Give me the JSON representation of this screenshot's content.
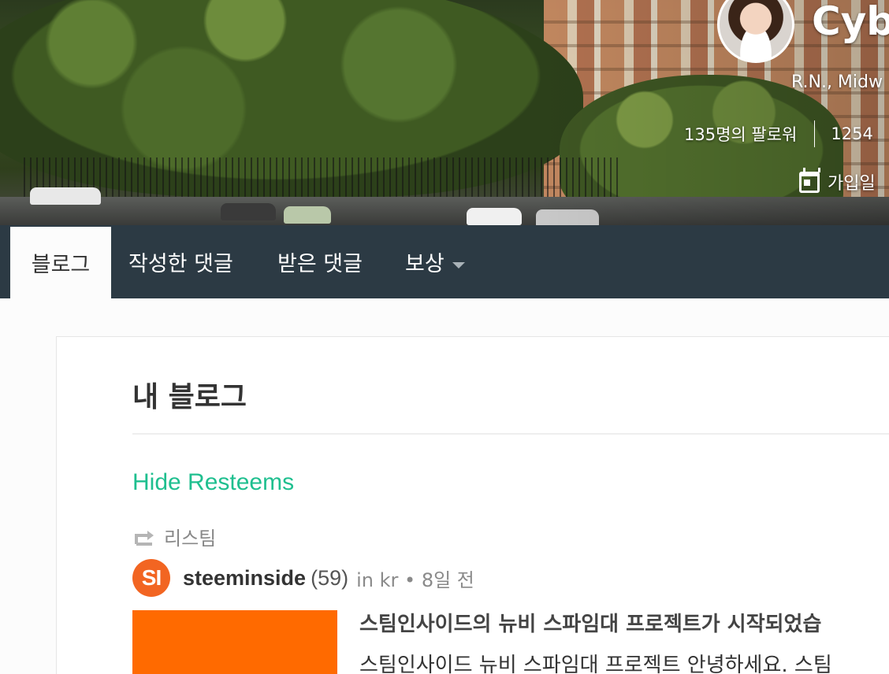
{
  "profile": {
    "name": "Cyb",
    "title": "R.N., Midw",
    "followers": "135명의 팔로워",
    "following": "1254",
    "joined": "가입일"
  },
  "nav": {
    "tabs": [
      {
        "label": "블로그",
        "active": true
      },
      {
        "label": "작성한 댓글",
        "active": false
      },
      {
        "label": "받은 댓글",
        "active": false
      },
      {
        "label": "보상",
        "active": false,
        "dropdown": true
      }
    ]
  },
  "blog": {
    "heading": "내 블로그",
    "hide_resteems": "Hide Resteems",
    "post": {
      "resteem_label": "리스팀",
      "author_initials": "SI",
      "author": "steeminside",
      "reputation": "(59)",
      "category_prefix": "in",
      "category": "kr",
      "separator": "•",
      "time": "8일 전",
      "title": "스팀인사이드의 뉴비 스파임대 프로젝트가 시작되었습",
      "excerpt": "스팀인사이드 뉴비 스파임대 프로젝트 안녕하세요. 스팀"
    }
  },
  "colors": {
    "nav_bg": "#2c3a44",
    "accent_green": "#1fbf8f",
    "author_avatar": "#f26522",
    "thumbnail": "#ff6a00"
  }
}
